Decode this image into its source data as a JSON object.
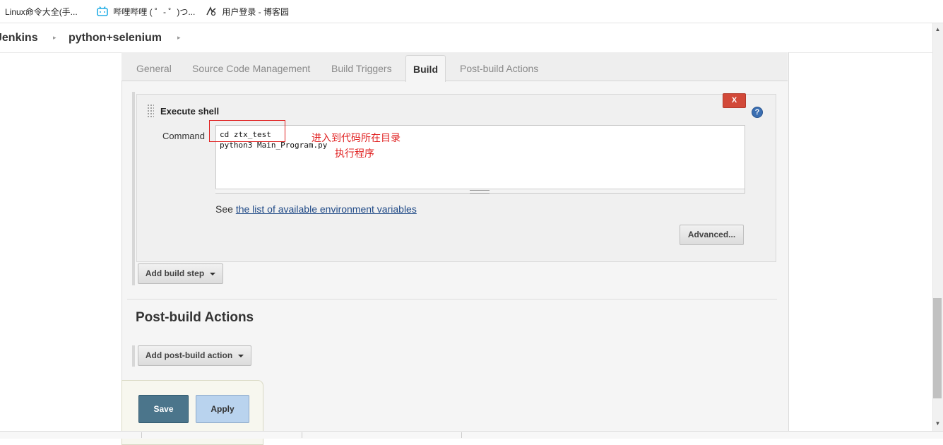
{
  "bookmarks": [
    {
      "label": "Linux命令大全(手...",
      "icon": "none"
    },
    {
      "label": "哔哩哔哩 ( ゜- ゜)つ...",
      "icon": "bilibili-icon"
    },
    {
      "label": "用户登录 - 博客园",
      "icon": "cnblogs-icon"
    }
  ],
  "breadcrumb": {
    "items": [
      "Jenkins",
      "python+selenium"
    ],
    "separator": "▸"
  },
  "tabs": {
    "general": "General",
    "scm": "Source Code Management",
    "triggers": "Build Triggers",
    "build": "Build",
    "post_build": "Post-build Actions",
    "active": "Build"
  },
  "build_step": {
    "title": "Execute shell",
    "delete_label": "X",
    "help_label": "?",
    "command_label": "Command",
    "command_lines": [
      "cd ztx_test",
      "python3 Main_Program.py"
    ],
    "annotation_1": "进入到代码所在目录",
    "annotation_2": "执行程序",
    "see_prefix": "See ",
    "see_link": "the list of available environment variables",
    "advanced_label": "Advanced..."
  },
  "add_build_step_label": "Add build step",
  "post_build": {
    "title": "Post-build Actions",
    "add_label": "Add post-build action"
  },
  "actions": {
    "save": "Save",
    "apply": "Apply"
  },
  "colors": {
    "save_button": "#4b758b",
    "apply_button": "#b9d3ee",
    "delete_button": "#d24939",
    "annotation": "#e02020",
    "link": "#204a87"
  }
}
